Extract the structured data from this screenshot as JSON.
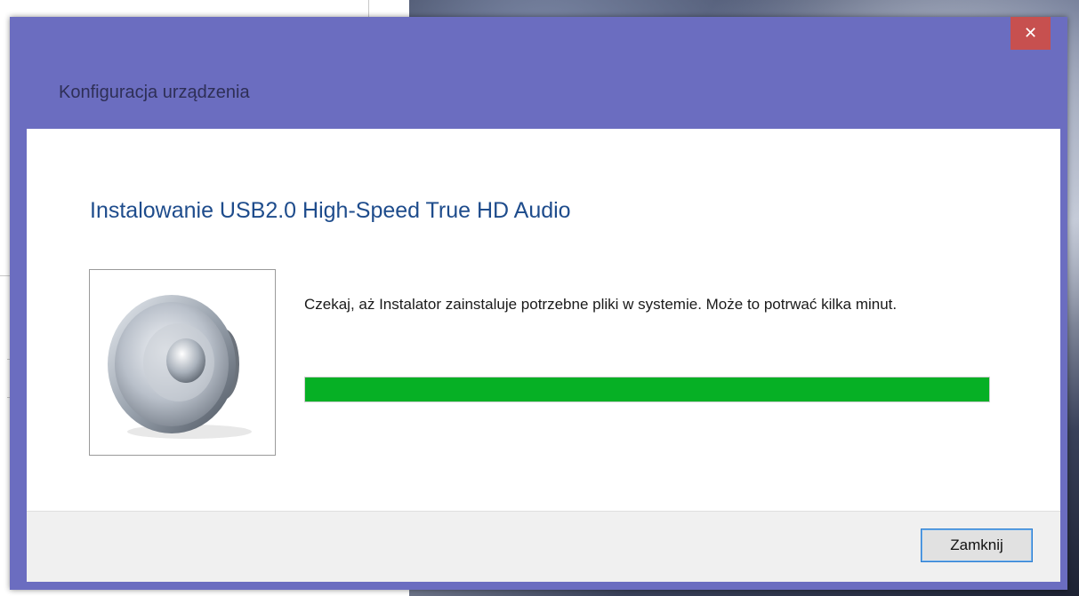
{
  "window": {
    "title": "Konfiguracja urządzenia",
    "close_glyph": "✕",
    "accent_color": "#6b6dc0",
    "close_color": "#c7504f"
  },
  "content": {
    "heading": "Instalowanie USB2.0 High-Speed True HD Audio",
    "message": "Czekaj, aż Instalator zainstaluje potrzebne pliki w systemie. Może to potrwać kilka minut.",
    "device_icon": "speaker-icon",
    "progress": {
      "percent": 100,
      "color": "#06b025"
    }
  },
  "footer": {
    "close_button_label": "Zamknij"
  }
}
